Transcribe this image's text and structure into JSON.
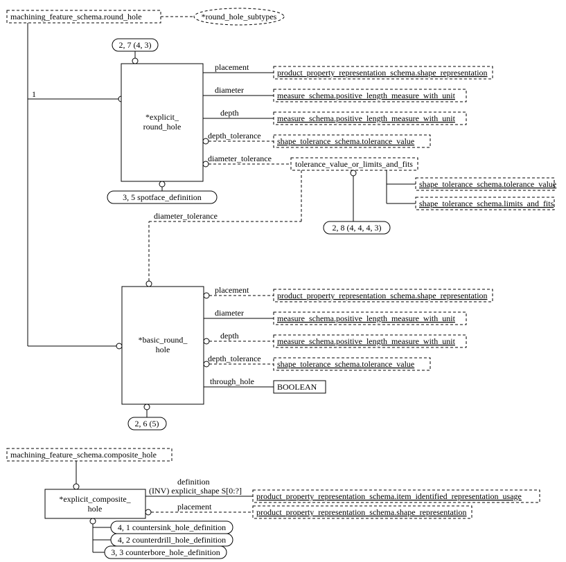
{
  "header": {
    "root1": "machining_feature_schema.round_hole",
    "root1_subtypes": "*round_hole_subtypes",
    "root2": "machining_feature_schema.composite_hole"
  },
  "entities": {
    "explicit_round_hole": "*explicit_\nround_hole",
    "basic_round_hole": "*basic_round_\nhole",
    "explicit_composite_hole": "*explicit_composite_\nhole"
  },
  "page_refs": {
    "explicit_round_hole_top": "2, 7 (4, 3)",
    "spotface": "3, 5 spotface_definition",
    "tol_select": "2, 8 (4, 4, 4, 3)",
    "basic_round_hole_bottom": "2, 6 (5)",
    "countersink": "4, 1 countersink_hole_definition",
    "counterdrill": "4, 2 counterdrill_hole_definition",
    "counterbore": "3, 3 counterbore_hole_definition"
  },
  "attr": {
    "placement": "placement",
    "diameter": "diameter",
    "depth": "depth",
    "depth_tolerance": "depth_tolerance",
    "diameter_tolerance": "diameter_tolerance",
    "through_hole": "through_hole",
    "definition_inv": "definition\n(INV) explicit_shape S[0:?]"
  },
  "types": {
    "shape_representation": "product_property_representation_schema.shape_representation",
    "plm": "measure_schema.positive_length_measure_with_unit",
    "tol_value": "shape_tolerance_schema.tolerance_value",
    "tol_select": "tolerance_value_or_limits_and_fits",
    "limits_fits": "shape_tolerance_schema.limits_and_fits",
    "boolean": "BOOLEAN",
    "item_rep_usage": "product_property_representation_schema.item_identified_representation_usage"
  },
  "labels": {
    "one": "1"
  }
}
